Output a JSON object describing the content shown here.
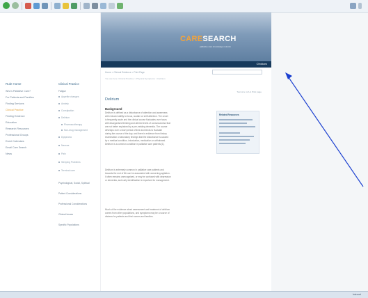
{
  "toolbar": {
    "icons": [
      "back-icon",
      "forward-icon",
      "stop-icon",
      "refresh-icon",
      "home-icon",
      "search-icon",
      "favorites-icon",
      "history-icon",
      "mail-icon",
      "print-icon",
      "edit-icon",
      "discuss-icon",
      "messenger-icon"
    ],
    "accent": "#f3a33a"
  },
  "logo": {
    "part_a": "CARE",
    "part_b": "SEARCH",
    "tagline": "palliative care knowledge network"
  },
  "navbar": {
    "right_link": "Clinicians"
  },
  "left_nav": {
    "title": "Rule Home",
    "items": [
      "Who's Palliative Care?",
      "For Patients and Families",
      "Finding Services",
      "Clinical Practice",
      "Finding Evidence",
      "Education",
      "Research Resources",
      "Professional Groups",
      "Event Calendars",
      "Email Care Search",
      "News"
    ],
    "active_index": 3
  },
  "sub_nav": {
    "title": "Clinical Practice",
    "items": [
      {
        "label": "Fatigue",
        "bullet": false
      },
      {
        "label": "Appetite changes",
        "bullet": true
      },
      {
        "label": "Anxiety",
        "bullet": true
      },
      {
        "label": "Constipation",
        "bullet": true
      },
      {
        "label": "Delirium",
        "bullet": true
      },
      {
        "label": "Pharmacotherapy",
        "bullet": true
      },
      {
        "label": "Non-drug management",
        "bullet": true
      },
      {
        "label": "Dyspnoea",
        "bullet": true
      },
      {
        "label": "Nausea",
        "bullet": true
      },
      {
        "label": "Pain",
        "bullet": true
      },
      {
        "label": "Sleeping Problems",
        "bullet": true
      },
      {
        "label": "Terminal care",
        "bullet": true
      },
      {
        "label": "Psychological, Social, Spiritual",
        "bullet": false
      },
      {
        "label": "Patient Considerations",
        "bullet": false
      },
      {
        "label": "Professional Considerations",
        "bullet": false
      },
      {
        "label": "Clinical Issues",
        "bullet": false
      },
      {
        "label": "Specific Populations",
        "bullet": false
      }
    ]
  },
  "content": {
    "breadcrumb": "Home > Clinical Evidence > Print Page",
    "breadcrumb_sub": "You are here: Clinical Practice > Physical Symptoms > Delirium",
    "tools": "Text size: A A A   Print page",
    "page_title": "Delirium",
    "section_heading": "Background",
    "paragraphs": [
      "Delirium is defined as a disturbance of attention and awareness",
      "with reduced ability to focus, sustain or shift attention. The onset",
      "is frequently acute and the clinical course fluctuates over hours",
      "with disorganised thinking and altered levels of consciousness that",
      "are not better explained by a pre-existing dementia. The course",
      "develops over a short period of time and tends to fluctuate",
      "during the course of the day, and there is evidence from history",
      "examination or laboratory findings that the disturbance is caused",
      "by a medical condition, intoxication, medication or withdrawal.",
      "Delirium is a common condition in palliative care patients [1].",
      "Delirium is extremely common in palliative care patients and",
      "towards the end of life can be associated with worsening agitation.",
      "It often remains unrecognised, or may be confused with depression",
      "or dementia, and early identification is important for management.",
      "Much of the evidence about assessment and treatment of delirium",
      "comes from other populations, and symptoms may be a source of",
      "distress for patients and their carers and families."
    ],
    "infobox": {
      "title": "Related Resources"
    }
  },
  "status": {
    "text": "Internet"
  }
}
